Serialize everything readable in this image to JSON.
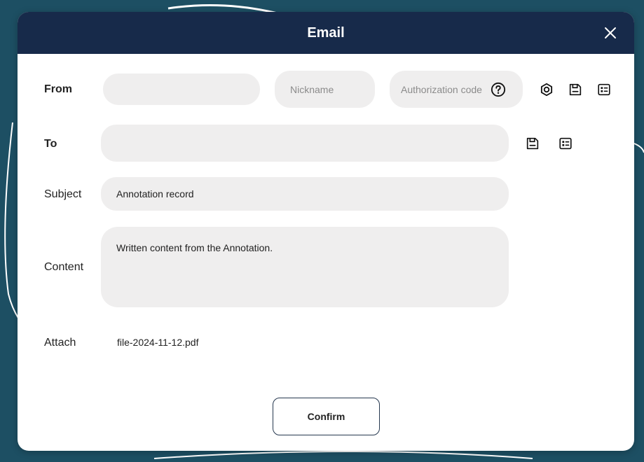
{
  "dialog": {
    "title": "Email",
    "close_icon": "close-icon"
  },
  "form": {
    "from": {
      "label": "From",
      "address_value": "",
      "nickname_placeholder": "Nickname",
      "auth_code_placeholder": "Authorization code",
      "icons": [
        "help-circle-icon",
        "settings-icon",
        "save-icon",
        "contacts-icon"
      ]
    },
    "to": {
      "label": "To",
      "value": "",
      "icons": [
        "save-icon",
        "contacts-icon"
      ]
    },
    "subject": {
      "label": "Subject",
      "value": "Annotation record"
    },
    "content": {
      "label": "Content",
      "value": "Written content from the Annotation."
    },
    "attach": {
      "label": "Attach",
      "filename": "file-2024-11-12.pdf"
    }
  },
  "actions": {
    "confirm_label": "Confirm"
  },
  "colors": {
    "titlebar": "#172a4a",
    "background": "#1d4f63",
    "field": "#efeeee"
  }
}
